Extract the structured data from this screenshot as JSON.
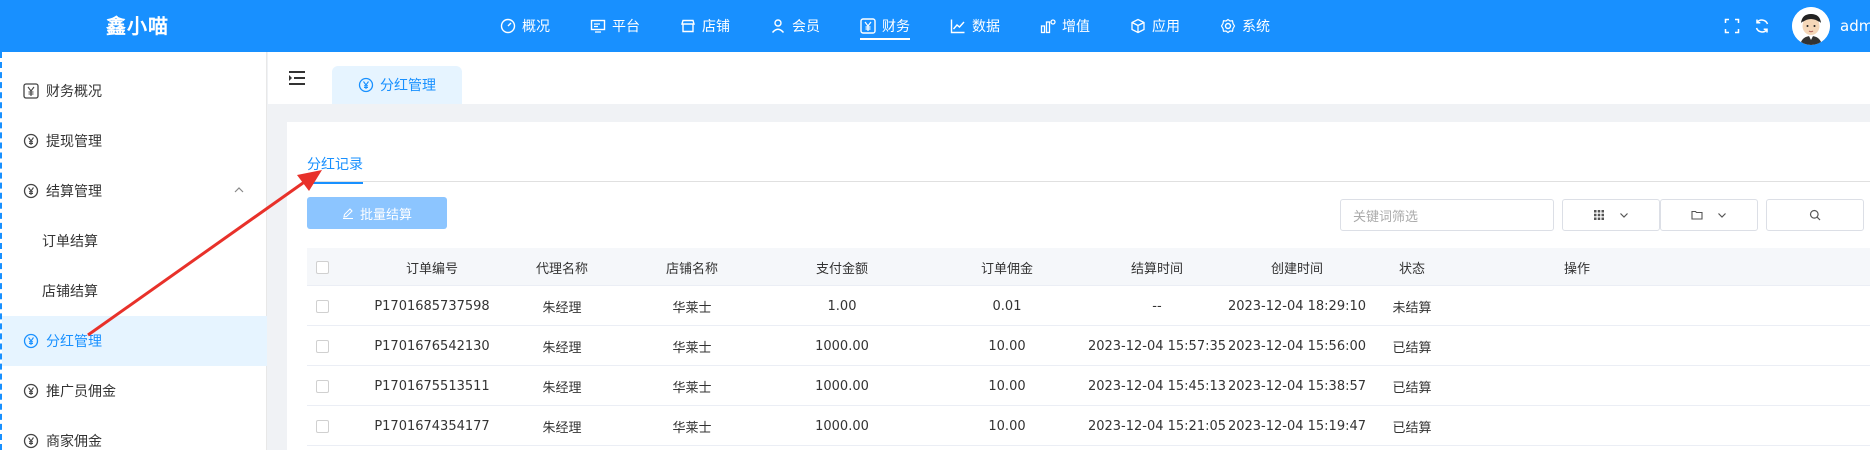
{
  "app": {
    "brand": "鑫小喵"
  },
  "nav": [
    {
      "label": "概况",
      "icon": "dashboard-icon"
    },
    {
      "label": "平台",
      "icon": "monitor-icon"
    },
    {
      "label": "店铺",
      "icon": "store-icon"
    },
    {
      "label": "会员",
      "icon": "user-icon"
    },
    {
      "label": "财务",
      "icon": "yen-icon",
      "active": true
    },
    {
      "label": "数据",
      "icon": "line-chart-icon"
    },
    {
      "label": "增值",
      "icon": "bar-chart-icon"
    },
    {
      "label": "应用",
      "icon": "cube-icon"
    },
    {
      "label": "系统",
      "icon": "gear-icon"
    }
  ],
  "user": {
    "name": "admin"
  },
  "sidebar": {
    "items": [
      {
        "label": "财务概况",
        "icon": "yen-box-icon"
      },
      {
        "label": "提现管理",
        "icon": "yen-circle-icon"
      },
      {
        "label": "结算管理",
        "icon": "yen-circle-icon",
        "expanded": true
      },
      {
        "label": "订单结算",
        "sub": true
      },
      {
        "label": "店铺结算",
        "sub": true
      },
      {
        "label": "分红管理",
        "icon": "yen-circle-icon",
        "active": true
      },
      {
        "label": "推广员佣金",
        "icon": "yen-circle-icon"
      },
      {
        "label": "商家佣金",
        "icon": "yen-circle-icon"
      }
    ]
  },
  "page_tab": {
    "label": "分红管理"
  },
  "subtab": {
    "label": "分红记录"
  },
  "toolbar": {
    "batch_label": "批量结算",
    "search_placeholder": "关键词筛选"
  },
  "table": {
    "headers": [
      "订单编号",
      "代理名称",
      "店铺名称",
      "支付金额",
      "订单佣金",
      "结算时间",
      "创建时间",
      "状态",
      "操作"
    ],
    "rows": [
      [
        "P1701685737598",
        "朱经理",
        "华莱士",
        "1.00",
        "0.01",
        "--",
        "2023-12-04 18:29:10",
        "未结算",
        ""
      ],
      [
        "P1701676542130",
        "朱经理",
        "华莱士",
        "1000.00",
        "10.00",
        "2023-12-04 15:57:35",
        "2023-12-04 15:56:00",
        "已结算",
        ""
      ],
      [
        "P1701675513511",
        "朱经理",
        "华莱士",
        "1000.00",
        "10.00",
        "2023-12-04 15:45:13",
        "2023-12-04 15:38:57",
        "已结算",
        ""
      ],
      [
        "P1701674354177",
        "朱经理",
        "华莱士",
        "1000.00",
        "10.00",
        "2023-12-04 15:21:05",
        "2023-12-04 15:19:47",
        "已结算",
        ""
      ]
    ]
  },
  "colors": {
    "primary": "#1890ff",
    "annotation_arrow": "#e8312a"
  }
}
